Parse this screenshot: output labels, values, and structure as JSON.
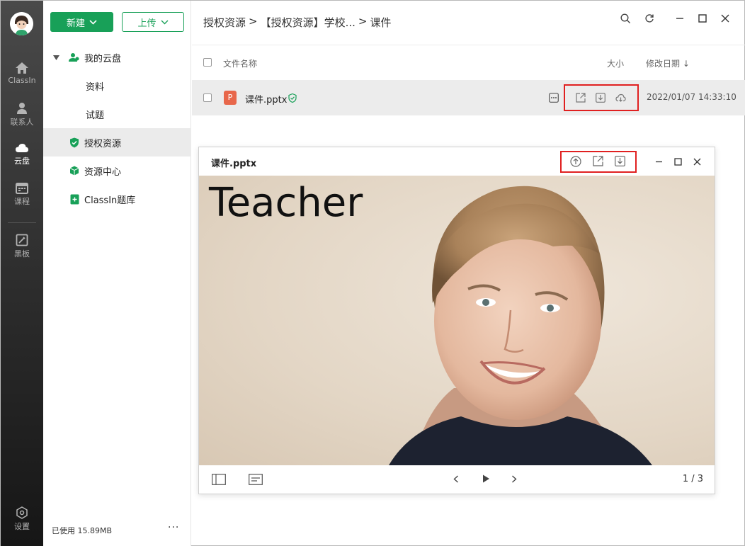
{
  "rail": {
    "items": [
      {
        "label": "ClassIn",
        "icon": "home-icon"
      },
      {
        "label": "联系人",
        "icon": "contacts-icon"
      },
      {
        "label": "云盘",
        "icon": "cloud-icon"
      },
      {
        "label": "课程",
        "icon": "calendar-icon"
      },
      {
        "label": "黑板",
        "icon": "blackboard-icon"
      },
      {
        "label": "设置",
        "icon": "settings-icon"
      }
    ]
  },
  "tree": {
    "new_label": "新建",
    "upload_label": "上传",
    "my_drive": "我的云盘",
    "sub_items": [
      "资料",
      "试题"
    ],
    "authorized": "授权资源",
    "resource_center": "资源中心",
    "question_bank": "ClassIn题库",
    "storage_used": "已使用 15.89MB",
    "more": "···"
  },
  "main": {
    "breadcrumb": [
      "授权资源",
      ">",
      "【授权资源】学校...",
      ">",
      "课件"
    ],
    "columns": {
      "name": "文件名称",
      "size": "大小",
      "modified": "修改日期 ↓"
    },
    "file": {
      "name": "课件.pptx",
      "modified": "2022/01/07 14:33:10"
    }
  },
  "preview": {
    "title": "课件.pptx",
    "slide_text": "Teacher",
    "page": "1 / 3"
  },
  "colors": {
    "accent": "#18a058",
    "highlight": "#e02020",
    "ppt": "#e8674b"
  }
}
